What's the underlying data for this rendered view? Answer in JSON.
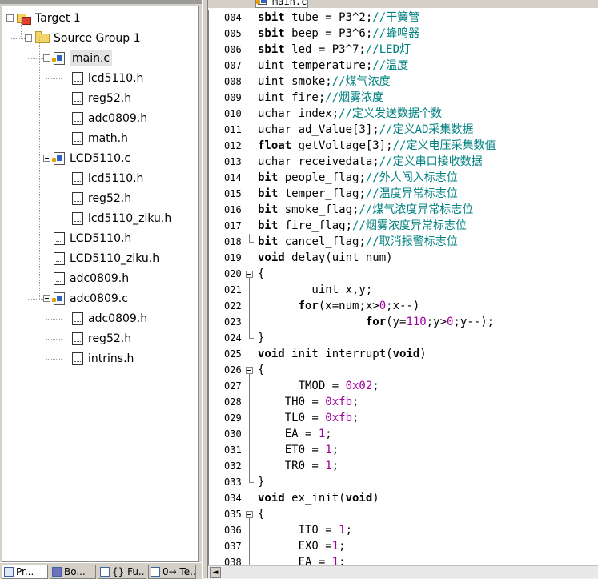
{
  "project": {
    "tree": [
      {
        "label": "Target 1",
        "kind": "target",
        "level": 0,
        "toggle": true
      },
      {
        "label": "Source Group 1",
        "kind": "folder",
        "level": 1,
        "toggle": true
      },
      {
        "label": "main.c",
        "kind": "c",
        "level": 2,
        "toggle": true,
        "selected": true
      },
      {
        "label": "lcd5110.h",
        "kind": "h",
        "level": 3
      },
      {
        "label": "reg52.h",
        "kind": "h",
        "level": 3
      },
      {
        "label": "adc0809.h",
        "kind": "h",
        "level": 3
      },
      {
        "label": "math.h",
        "kind": "h",
        "level": 3
      },
      {
        "label": "LCD5110.c",
        "kind": "c",
        "level": 2,
        "toggle": true
      },
      {
        "label": "lcd5110.h",
        "kind": "h",
        "level": 3
      },
      {
        "label": "reg52.h",
        "kind": "h",
        "level": 3
      },
      {
        "label": "lcd5110_ziku.h",
        "kind": "h",
        "level": 3
      },
      {
        "label": "LCD5110.h",
        "kind": "h",
        "level": 2
      },
      {
        "label": "LCD5110_ziku.h",
        "kind": "h",
        "level": 2
      },
      {
        "label": "adc0809.h",
        "kind": "h",
        "level": 2
      },
      {
        "label": "adc0809.c",
        "kind": "c",
        "level": 2,
        "toggle": true
      },
      {
        "label": "adc0809.h",
        "kind": "h",
        "level": 3
      },
      {
        "label": "reg52.h",
        "kind": "h",
        "level": 3
      },
      {
        "label": "intrins.h",
        "kind": "h",
        "level": 3
      }
    ],
    "tabs": [
      {
        "label": "Pr...",
        "icon": "project-icon",
        "active": true
      },
      {
        "label": "Bo...",
        "icon": "books-icon",
        "active": false
      },
      {
        "label": "{} Fu...",
        "icon": "functions-icon",
        "active": false
      },
      {
        "label": "0→ Te...",
        "icon": "templates-icon",
        "active": false
      }
    ]
  },
  "editor": {
    "file_tab": "main.c",
    "lines": [
      {
        "n": "004",
        "t": [
          [
            "kw",
            "sbit"
          ],
          [
            "pl",
            " tube = P3^2;"
          ],
          [
            "cm",
            "//干簧管"
          ]
        ]
      },
      {
        "n": "005",
        "t": [
          [
            "kw",
            "sbit"
          ],
          [
            "pl",
            " beep = P3^6;"
          ],
          [
            "cm",
            "//蜂鸣器"
          ]
        ]
      },
      {
        "n": "006",
        "t": [
          [
            "kw",
            "sbit"
          ],
          [
            "pl",
            " led = P3^7;"
          ],
          [
            "cm",
            "//LED灯"
          ]
        ]
      },
      {
        "n": "007",
        "t": [
          [
            "pl",
            "uint temperature;"
          ],
          [
            "cm",
            "//温度"
          ]
        ]
      },
      {
        "n": "008",
        "t": [
          [
            "pl",
            "uint smoke;"
          ],
          [
            "cm",
            "//煤气浓度"
          ]
        ]
      },
      {
        "n": "009",
        "t": [
          [
            "pl",
            "uint fire;"
          ],
          [
            "cm",
            "//烟雾浓度"
          ]
        ]
      },
      {
        "n": "010",
        "t": [
          [
            "pl",
            "uchar index;"
          ],
          [
            "cm",
            "//定义发送数据个数"
          ]
        ]
      },
      {
        "n": "011",
        "t": [
          [
            "pl",
            "uchar ad_Value[3];"
          ],
          [
            "cm",
            "//定义AD采集数据"
          ]
        ]
      },
      {
        "n": "012",
        "t": [
          [
            "kw",
            "float"
          ],
          [
            "pl",
            " getVoltage[3];"
          ],
          [
            "cm",
            "//定义电压采集数值"
          ]
        ]
      },
      {
        "n": "013",
        "t": [
          [
            "pl",
            "uchar receivedata;"
          ],
          [
            "cm",
            "//定义串口接收数据"
          ]
        ]
      },
      {
        "n": "014",
        "t": [
          [
            "kw",
            "bit"
          ],
          [
            "pl",
            " people_flag;"
          ],
          [
            "cm",
            "//外人闯入标志位"
          ]
        ]
      },
      {
        "n": "015",
        "t": [
          [
            "kw",
            "bit"
          ],
          [
            "pl",
            " temper_flag;"
          ],
          [
            "cm",
            "//温度异常标志位"
          ]
        ]
      },
      {
        "n": "016",
        "t": [
          [
            "kw",
            "bit"
          ],
          [
            "pl",
            " smoke_flag;"
          ],
          [
            "cm",
            "//煤气浓度异常标志位"
          ]
        ]
      },
      {
        "n": "017",
        "t": [
          [
            "kw",
            "bit"
          ],
          [
            "pl",
            " fire_flag;"
          ],
          [
            "cm",
            "//烟雾浓度异常标志位"
          ]
        ]
      },
      {
        "n": "018",
        "fold": "end",
        "t": [
          [
            "kw",
            "bit"
          ],
          [
            "pl",
            " cancel_flag;"
          ],
          [
            "cm",
            "//取消报警标志位"
          ]
        ]
      },
      {
        "n": "019",
        "t": [
          [
            "kw",
            "void"
          ],
          [
            "pl",
            " delay(uint num)"
          ]
        ]
      },
      {
        "n": "020",
        "fold": "open",
        "t": [
          [
            "pl",
            "{"
          ]
        ]
      },
      {
        "n": "021",
        "fold": "bar",
        "t": [
          [
            "pl",
            "        uint x,y;"
          ]
        ]
      },
      {
        "n": "022",
        "fold": "bar",
        "t": [
          [
            "pl",
            "      "
          ],
          [
            "kw",
            "for"
          ],
          [
            "pl",
            "(x=num;x>"
          ],
          [
            "nm",
            "0"
          ],
          [
            "pl",
            ";x--)"
          ]
        ]
      },
      {
        "n": "023",
        "fold": "bar",
        "t": [
          [
            "pl",
            "                "
          ],
          [
            "kw",
            "for"
          ],
          [
            "pl",
            "(y="
          ],
          [
            "nm",
            "110"
          ],
          [
            "pl",
            ";y>"
          ],
          [
            "nm",
            "0"
          ],
          [
            "pl",
            ";y--);"
          ]
        ]
      },
      {
        "n": "024",
        "fold": "end",
        "t": [
          [
            "pl",
            "}"
          ]
        ]
      },
      {
        "n": "025",
        "t": [
          [
            "kw",
            "void"
          ],
          [
            "pl",
            " init_interrupt("
          ],
          [
            "kw",
            "void"
          ],
          [
            "pl",
            ")"
          ]
        ]
      },
      {
        "n": "026",
        "fold": "open",
        "t": [
          [
            "pl",
            "{"
          ]
        ]
      },
      {
        "n": "027",
        "fold": "bar",
        "t": [
          [
            "pl",
            "      TMOD = "
          ],
          [
            "nm",
            "0x02"
          ],
          [
            "pl",
            ";"
          ]
        ]
      },
      {
        "n": "028",
        "fold": "bar",
        "t": [
          [
            "pl",
            "    TH0 = "
          ],
          [
            "nm",
            "0xfb"
          ],
          [
            "pl",
            ";"
          ]
        ]
      },
      {
        "n": "029",
        "fold": "bar",
        "t": [
          [
            "pl",
            "    TL0 = "
          ],
          [
            "nm",
            "0xfb"
          ],
          [
            "pl",
            ";"
          ]
        ]
      },
      {
        "n": "030",
        "fold": "bar",
        "t": [
          [
            "pl",
            "    EA = "
          ],
          [
            "nm",
            "1"
          ],
          [
            "pl",
            ";"
          ]
        ]
      },
      {
        "n": "031",
        "fold": "bar",
        "t": [
          [
            "pl",
            "    ET0 = "
          ],
          [
            "nm",
            "1"
          ],
          [
            "pl",
            ";"
          ]
        ]
      },
      {
        "n": "032",
        "fold": "bar",
        "t": [
          [
            "pl",
            "    TR0 = "
          ],
          [
            "nm",
            "1"
          ],
          [
            "pl",
            ";"
          ]
        ]
      },
      {
        "n": "033",
        "fold": "end",
        "t": [
          [
            "pl",
            "}"
          ]
        ]
      },
      {
        "n": "034",
        "t": [
          [
            "kw",
            "void"
          ],
          [
            "pl",
            " ex_init("
          ],
          [
            "kw",
            "void"
          ],
          [
            "pl",
            ")"
          ]
        ]
      },
      {
        "n": "035",
        "fold": "open",
        "t": [
          [
            "pl",
            "{"
          ]
        ]
      },
      {
        "n": "036",
        "fold": "bar",
        "t": [
          [
            "pl",
            "      IT0 = "
          ],
          [
            "nm",
            "1"
          ],
          [
            "pl",
            ";"
          ]
        ]
      },
      {
        "n": "037",
        "fold": "bar",
        "t": [
          [
            "pl",
            "      EX0 ="
          ],
          [
            "nm",
            "1"
          ],
          [
            "pl",
            ";"
          ]
        ]
      },
      {
        "n": "038",
        "fold": "bar",
        "t": [
          [
            "pl",
            "      EA = "
          ],
          [
            "nm",
            "1"
          ],
          [
            "pl",
            ";"
          ]
        ]
      }
    ]
  },
  "scrollbar": {
    "left_arrow": "◄"
  },
  "colors": {
    "keyword": "#000000",
    "number": "#a000a0",
    "comment": "#008080",
    "selection": "#e3e3e3"
  }
}
